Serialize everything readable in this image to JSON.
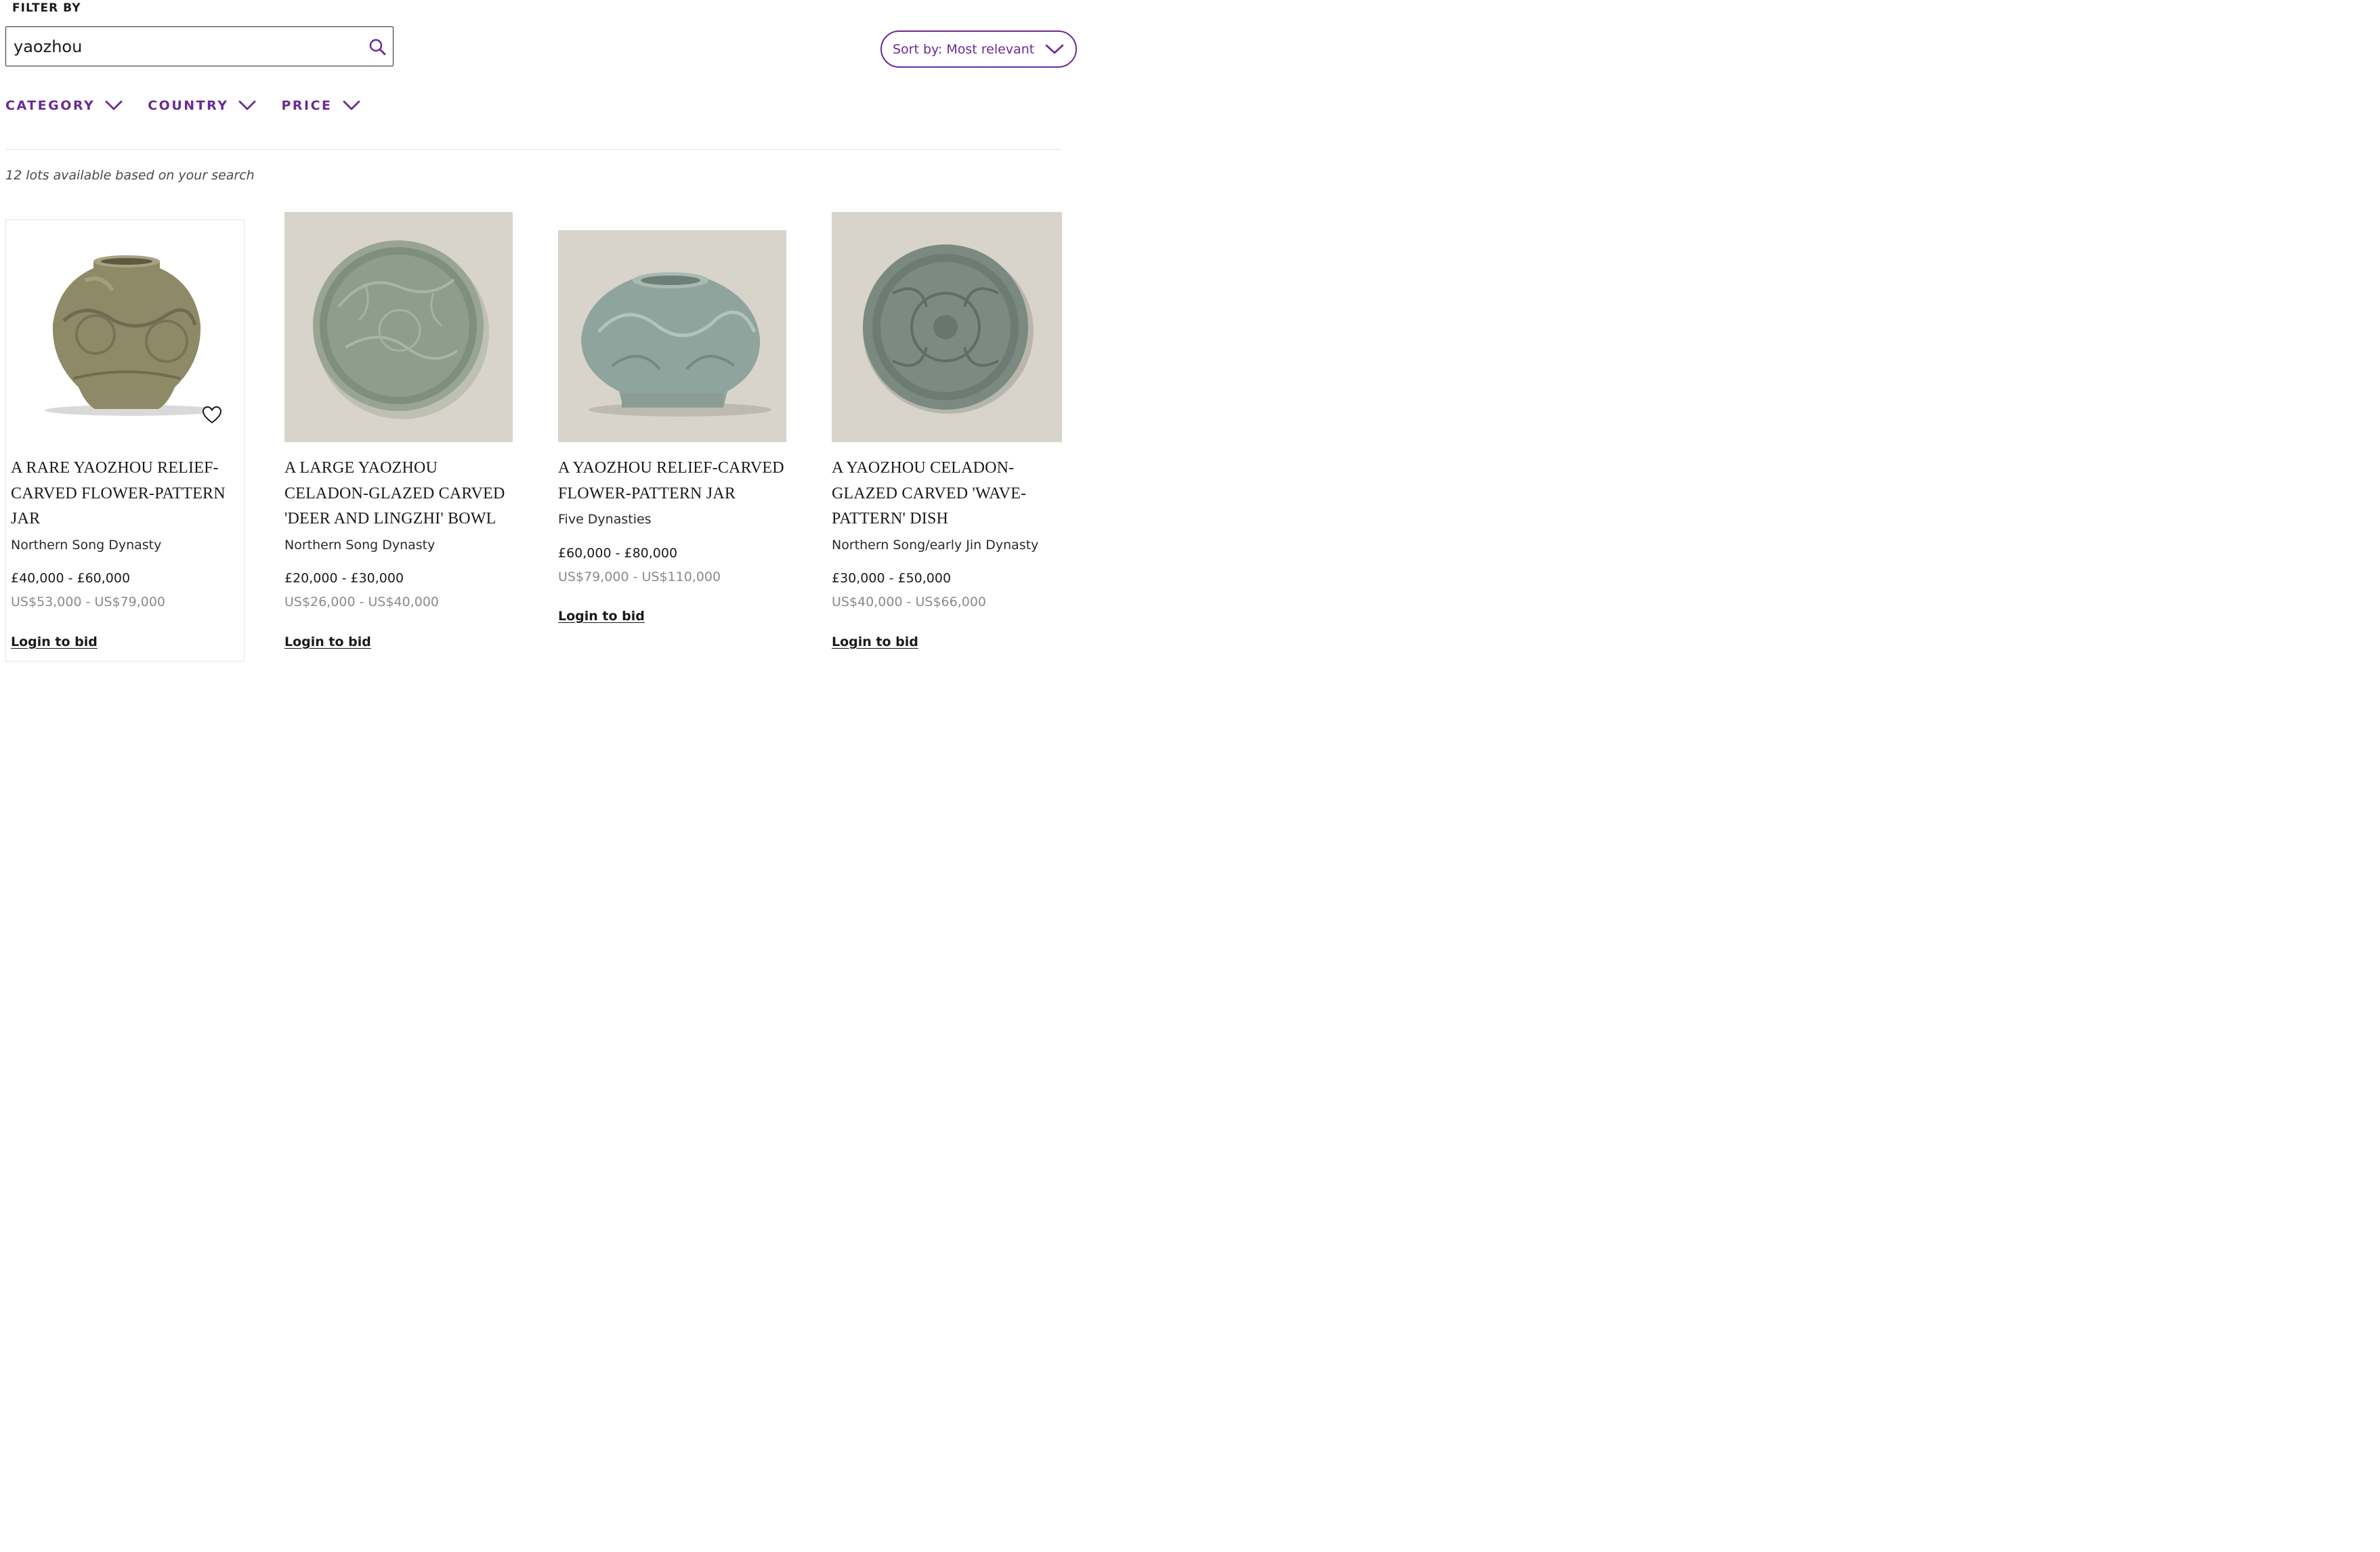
{
  "filter": {
    "label": "FILTER BY",
    "search_value": "yaozhou"
  },
  "sort": {
    "label": "Sort by: Most relevant"
  },
  "filters": {
    "category": "CATEGORY",
    "country": "COUNTRY",
    "price": "PRICE"
  },
  "results": {
    "count_text": "12 lots available based on your search"
  },
  "colors": {
    "accent": "#6b2a94",
    "image_bg": "#d9d4cb",
    "usd_text": "#8a8a8a"
  },
  "lots": [
    {
      "title_lines": [
        "A RARE YAOZHOU RELIEF-",
        "CARVED FLOWER-PATTERN",
        "JAR"
      ],
      "period": "Northern Song Dynasty",
      "estimate": "£40,000 - £60,000",
      "usd": "US$53,000 - US$79,000",
      "cta": "Login to bid"
    },
    {
      "title_lines": [
        "A LARGE YAOZHOU",
        "CELADON-GLAZED CARVED",
        "'DEER AND LINGZHI' BOWL"
      ],
      "period": "Northern Song Dynasty",
      "estimate": "£20,000 - £30,000",
      "usd": "US$26,000 - US$40,000",
      "cta": "Login to bid"
    },
    {
      "title_lines": [
        "A YAOZHOU RELIEF-CARVED",
        "FLOWER-PATTERN JAR"
      ],
      "period": "Five Dynasties",
      "estimate": "£60,000 - £80,000",
      "usd": "US$79,000 - US$110,000",
      "cta": "Login to bid"
    },
    {
      "title_lines": [
        "A YAOZHOU CELADON-",
        "GLAZED CARVED 'WAVE-",
        "PATTERN' DISH"
      ],
      "period": "Northern Song/early Jin Dynasty",
      "estimate": "£30,000 - £50,000",
      "usd": "US$40,000 - US$66,000",
      "cta": "Login to bid"
    }
  ]
}
